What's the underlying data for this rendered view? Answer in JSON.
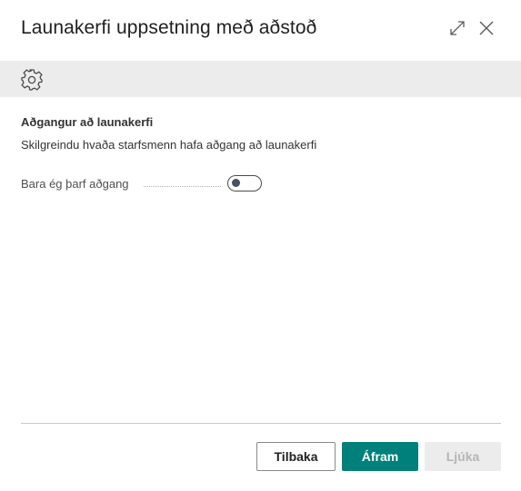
{
  "dialog": {
    "title": "Launakerfi uppsetning með aðstoð",
    "expand_icon": "expand-icon",
    "close_icon": "close-icon"
  },
  "toolbar": {
    "settings_icon": "gear-icon"
  },
  "section": {
    "title": "Aðgangur að launakerfi",
    "description": "Skilgreindu hvaða starfsmenn hafa aðgang að launakerfi"
  },
  "field": {
    "label": "Bara ég þarf aðgang",
    "toggle_on": false
  },
  "buttons": {
    "back": "Tilbaka",
    "next": "Áfram",
    "finish": "Ljúka"
  },
  "colors": {
    "primary": "#00807a",
    "toolbar_bg": "#ececec",
    "disabled_bg": "#ececec",
    "disabled_text": "#b5b5b5"
  }
}
